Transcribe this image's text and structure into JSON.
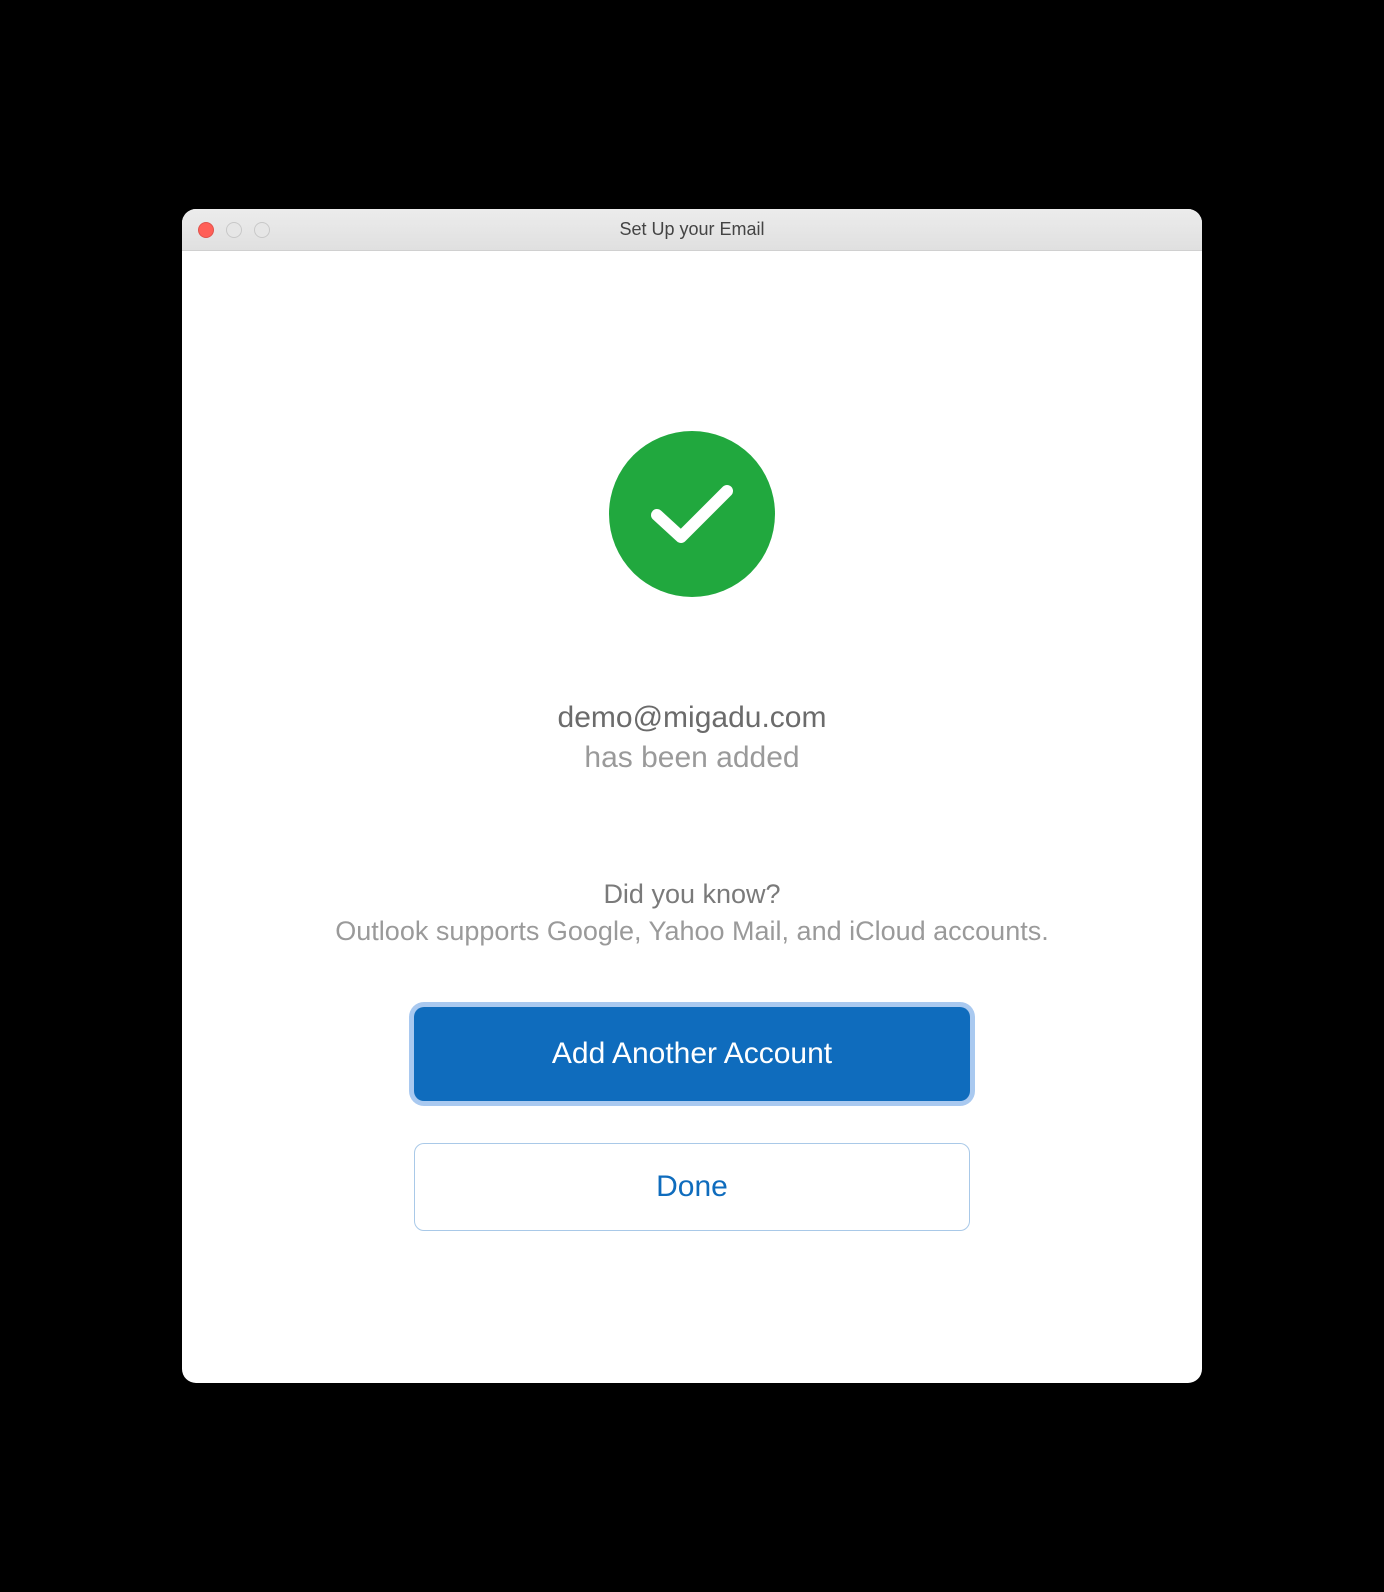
{
  "window": {
    "title": "Set Up your Email"
  },
  "success": {
    "email": "demo@migadu.com",
    "added_text": "has been added"
  },
  "tip": {
    "heading": "Did you know?",
    "body": "Outlook supports Google, Yahoo Mail, and iCloud accounts."
  },
  "buttons": {
    "primary": "Add Another Account",
    "secondary": "Done"
  }
}
